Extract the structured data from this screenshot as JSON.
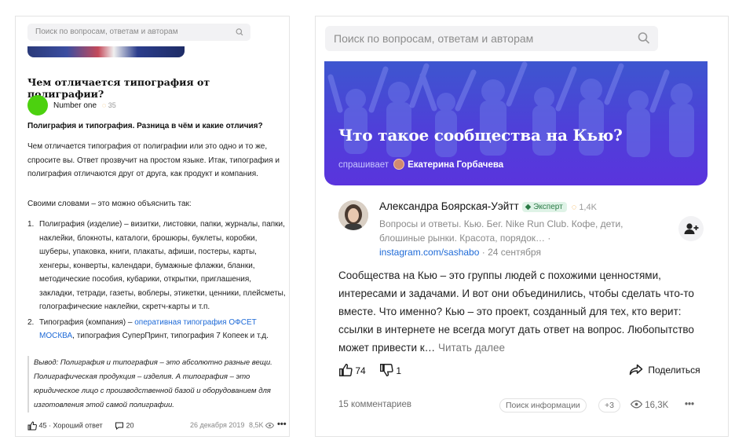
{
  "left": {
    "search_placeholder": "Поиск по вопросам, ответам и авторам",
    "question_title": "Чем отличается типография от полиграфии?",
    "author_name": "Number one",
    "author_score": "35",
    "answer_heading": "Полиграфия и типография. Разница в чём и какие отличия?",
    "para1": "Чем отличается типография от полиграфии или это одно и то же, спросите вы. Ответ прозвучит на простом языке. Итак, типография и полиграфия отличаются друг от друга, как продукт и компания.",
    "para2": "Своими словами – это можно объяснить так:",
    "list1_num": "1.",
    "list1_text": "Полиграфия (изделие) – визитки, листовки, папки, журналы, папки, наклейки, блокноты, каталоги, брошюры, буклеты, коробки, шуберы, упаковка, книги, плакаты, афиши, постеры, карты, хенгеры, конверты, календари, бумажные флажки, бланки, методические пособия, кубарики, открытки, приглашения, закладки, тетради, газеты, воблеры, этикетки, ценники, плейсметы, голографические наклейки, скретч-карты и т.п.",
    "list2_num": "2.",
    "list2_pre": "Типография (компания) – ",
    "list2_link": "оперативная типография ОФСЕТ МОСКВА",
    "list2_post": ", типография СуперПринт, типография 7 Копеек и т.д.",
    "quote": "Вывод: Полиграфия и типография – это абсолютно разные вещи. Полиграфическая продукция – изделия. А типография – это юридическое лицо с производственной базой и оборудованием для изготовления этой самой полиграфии.",
    "likes": "45",
    "good_answer": "Хороший ответ",
    "comments": "20",
    "date": "26 декабря 2019",
    "views": "8,5K"
  },
  "right": {
    "search_placeholder": "Поиск по вопросам, ответам и авторам",
    "hero_title": "Что такое сообщества на Кью?",
    "asks_label": "спрашивает",
    "asker_name": "Екатерина Горбачева",
    "author_name": "Александра Боярская-Уэйтт",
    "expert_badge": "Эксперт",
    "author_score": "1,4K",
    "bio": "Вопросы и ответы. Кью. Бег. Nike Run Club. Кофе, дети, блошиные рынки. Красота, порядок… ·",
    "bio_link": "instagram.com/sashabo",
    "bio_date": " · 24 сентября",
    "answer_text": "Сообщества на Кью – это группы людей с похожими ценностями, интересами и задачами. И вот они объединились, чтобы сделать что-то вместе. Что именно? Кью – это проект, созданный для тех, кто верит: ссылки в интернете не всегда могут дать ответ на вопрос. Любопытство может привести к…",
    "read_more": "Читать далее",
    "likes": "74",
    "dislikes": "1",
    "share": "Поделиться",
    "comments": "15 комментариев",
    "tag": "Поиск информации",
    "tag_more": "+3",
    "views": "16,3K",
    "more": "•••"
  },
  "colors": {
    "accent_blue": "#1e6ad7",
    "hero_purple": "#4f3fd9",
    "score_orange": "#f0a233",
    "expert_green": "#2a7a45",
    "avatar_green": "#4cd10f"
  }
}
